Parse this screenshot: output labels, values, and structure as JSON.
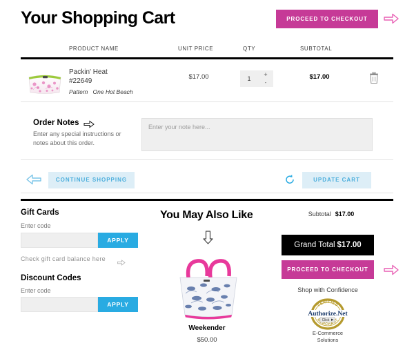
{
  "header": {
    "title": "Your Shopping Cart",
    "checkout_label": "PROCEED TO CHECKOUT",
    "arrow_icon": "arrow-right-icon"
  },
  "table": {
    "columns": {
      "product_name": "PRODUCT NAME",
      "unit_price": "UNIT PRICE",
      "qty": "QTY",
      "subtotal": "SUBTOTAL"
    },
    "rows": [
      {
        "name": "Packin' Heat",
        "sku": "#22649",
        "attribute_label": "Pattern",
        "attribute_value": "One Hot Beach",
        "unit_price": "$17.00",
        "qty": "1",
        "qty_increase": "+",
        "qty_decrease": "-",
        "subtotal": "$17.00",
        "remove_icon": "trash-icon"
      }
    ]
  },
  "order_notes": {
    "title": "Order Notes",
    "title_arrow_icon": "arrow-right-icon",
    "description": "Enter any special instructions or notes about this order.",
    "placeholder": "Enter your note here...",
    "value": ""
  },
  "actions": {
    "back_arrow_icon": "arrow-left-icon",
    "continue_label": "CONTINUE SHOPPING",
    "refresh_icon": "refresh-icon",
    "update_label": "UPDATE CART"
  },
  "gift_cards": {
    "title": "Gift Cards",
    "label": "Enter code",
    "placeholder": "",
    "value": "",
    "apply_label": "APPLY",
    "balance_link": "Check gift card balance here",
    "balance_arrow_icon": "arrow-right-icon"
  },
  "discount_codes": {
    "title": "Discount Codes",
    "label": "Enter code",
    "placeholder": "",
    "value": "",
    "apply_label": "APPLY"
  },
  "upsell": {
    "title": "You May Also Like",
    "arrow_icon": "arrow-down-icon",
    "product_name": "Weekender",
    "product_price": "$50.00"
  },
  "totals": {
    "subtotal_label": "Subtotal",
    "subtotal_value": "$17.00",
    "grand_total_label": "Grand Total",
    "grand_total_value": "$17.00",
    "checkout_label": "PROCEED TO CHECKOUT",
    "checkout_arrow_icon": "arrow-right-icon",
    "confidence_label": "Shop with Confidence",
    "seal_brand": "Authorize",
    "seal_brand_suffix": ".Net",
    "seal_click": "Click",
    "seal_top_text": "VERIFIED",
    "seal_bottom_text": "MERCHANT",
    "seal_caption_line1": "E-Commerce",
    "seal_caption_line2": "Solutions"
  },
  "colors": {
    "magenta": "#c63a97",
    "cyan": "#29abe2",
    "soft_blue_bg": "#ddeef7",
    "soft_blue_text": "#4baedc",
    "black": "#000000",
    "gold": "#b59a2e"
  }
}
